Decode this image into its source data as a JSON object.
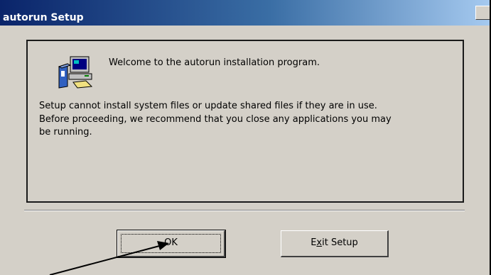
{
  "window": {
    "title": "autorun Setup"
  },
  "panel": {
    "welcome_text": "Welcome to the autorun installation program.",
    "body_line_1": "Setup cannot install system files or update shared files if they are in use.",
    "body_line_2": "Before proceeding, we recommend that you close any applications you may",
    "body_line_3": "be running.",
    "icon": "setup-computer-icon"
  },
  "buttons": {
    "ok_label": "OK",
    "exit_label": "Exit Setup",
    "exit_mnemonic": "x"
  },
  "annotation": {
    "pointer": "arrow-pointing-to-ok"
  },
  "colors": {
    "title_start": "#0a246a",
    "title_end": "#a6caf0",
    "dialog_bg": "#d4d0c8"
  }
}
